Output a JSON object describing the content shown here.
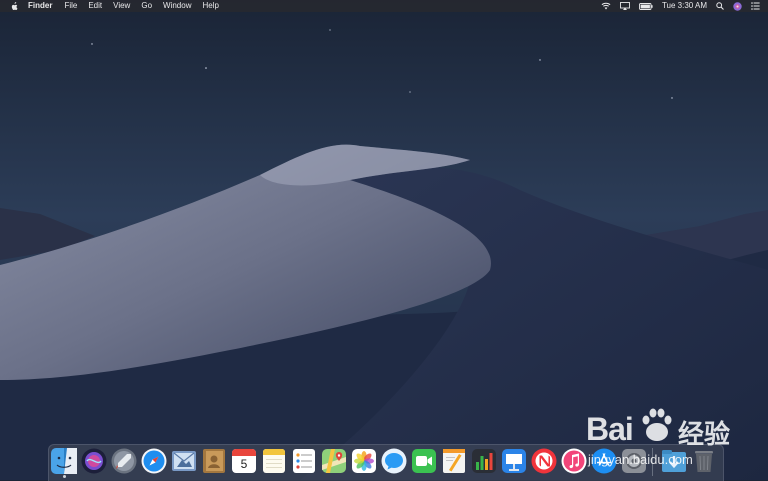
{
  "menubar": {
    "app_name": "Finder",
    "menus": [
      "File",
      "Edit",
      "View",
      "Go",
      "Window",
      "Help"
    ],
    "status_icons": [
      "wifi-icon",
      "airplay-icon",
      "battery-icon"
    ],
    "clock": "Tue 3:30 AM",
    "right_icons": [
      "spotlight-icon",
      "siri-icon",
      "notification-center-icon"
    ]
  },
  "dock": {
    "apps": [
      "Finder",
      "Siri",
      "Launchpad",
      "Safari",
      "Mail",
      "Contacts",
      "Calendar",
      "Notes",
      "Reminders",
      "Maps",
      "Photos",
      "Messages",
      "FaceTime",
      "Pages",
      "Numbers",
      "Keynote",
      "News",
      "iTunes",
      "App Store",
      "System Preferences",
      "Downloads",
      "Trash"
    ],
    "calendar_date": "5"
  },
  "watermark": {
    "brand": "Bai",
    "cn": "经验",
    "url": "jingyan.baidu.com"
  }
}
